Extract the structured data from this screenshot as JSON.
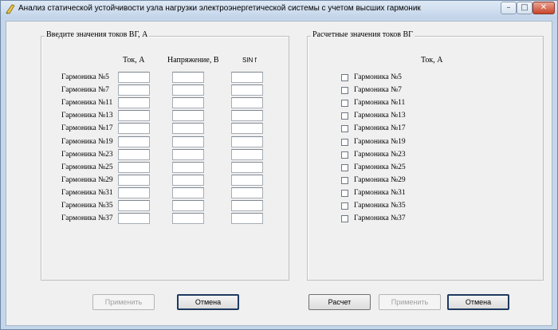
{
  "window": {
    "title": "Анализ статической устойчивости узла нагрузки электроэнергетической системы с учетом высших гармоник",
    "minimize_icon": "minimize-icon",
    "maximize_icon": "maximize-icon",
    "close_icon": "close-icon",
    "min_glyph": "–",
    "max_glyph": "□",
    "close_glyph": "✕"
  },
  "left_group": {
    "title": "Введите значения токов ВГ, А",
    "columns": [
      "Ток, А",
      "Напряжение, В",
      "SIN f"
    ],
    "rows": [
      "Гармоника №5",
      "Гармоника №7",
      "Гармоника №11",
      "Гармоника №13",
      "Гармоника №17",
      "Гармоника №19",
      "Гармоника №23",
      "Гармоника №25",
      "Гармоника №29",
      "Гармоника №31",
      "Гармоника №35",
      "Гармоника №37"
    ]
  },
  "right_group": {
    "title": "Расчетные значения токов ВГ",
    "column": "Ток, А",
    "rows": [
      "Гармоника №5",
      "Гармоника №7",
      "Гармоника №11",
      "Гармоника №13",
      "Гармоника №17",
      "Гармоника №19",
      "Гармоника №23",
      "Гармоника №25",
      "Гармоника №29",
      "Гармоника №31",
      "Гармоника №35",
      "Гармоника №37"
    ]
  },
  "buttons": {
    "apply_left": "Применить",
    "cancel_left": "Отмена",
    "calc": "Расчет",
    "apply_right": "Применить",
    "cancel_right": "Отмена"
  }
}
